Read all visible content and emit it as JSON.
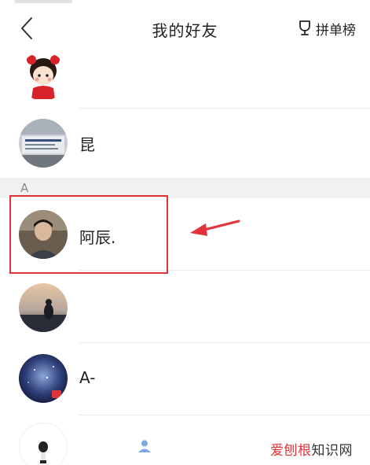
{
  "header": {
    "title": "我的好友",
    "ranking_label": "拼单榜"
  },
  "sections": {
    "a_letter": "A"
  },
  "contacts": [
    {
      "name": ""
    },
    {
      "name": "昆"
    },
    {
      "name": "阿辰."
    },
    {
      "name": ""
    },
    {
      "name": "A-"
    },
    {
      "name": ""
    }
  ],
  "watermark": {
    "accent_text": "爱刨根",
    "rest_text": "知识网"
  },
  "colors": {
    "highlight": "#e0333a",
    "section_bg": "#f1f1f1",
    "divider": "#ececec"
  }
}
